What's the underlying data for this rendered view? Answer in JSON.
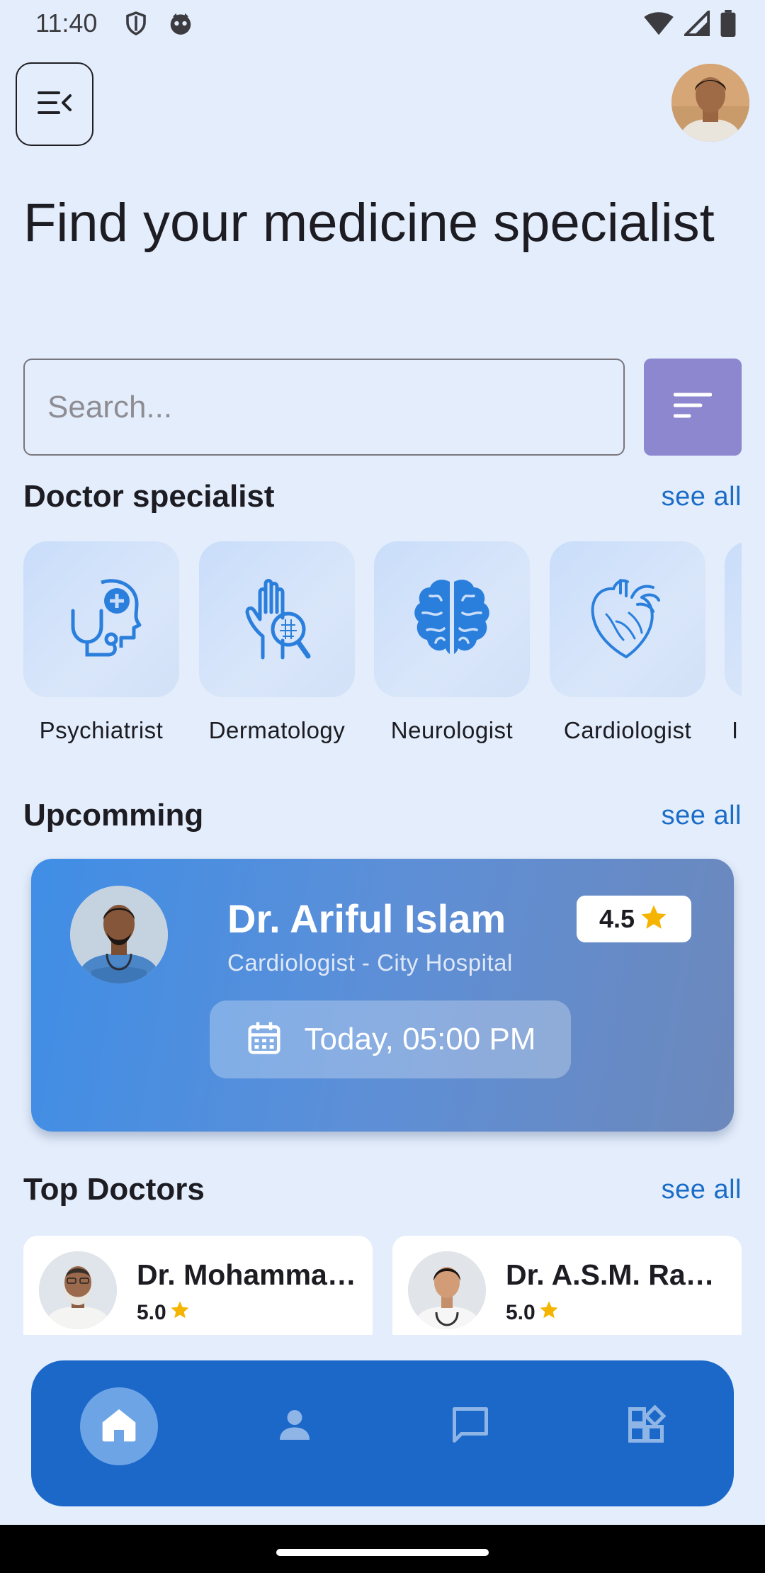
{
  "status_bar": {
    "time": "11:40"
  },
  "header": {
    "title": "Find your medicine specialist"
  },
  "search": {
    "placeholder": "Search..."
  },
  "specialists": {
    "title": "Doctor specialist",
    "see_all": "see all",
    "items": [
      {
        "label": "Psychiatrist",
        "icon": "psychiatry-icon"
      },
      {
        "label": "Dermatology",
        "icon": "dermatology-icon"
      },
      {
        "label": "Neurologist",
        "icon": "brain-icon"
      },
      {
        "label": "Cardiologist",
        "icon": "heart-icon"
      }
    ]
  },
  "upcoming": {
    "title": "Upcomming",
    "see_all": "see all",
    "card": {
      "name": "Dr. Ariful Islam",
      "subtitle": "Cardiologist - City Hospital",
      "rating": "4.5",
      "time": "Today, 05:00 PM"
    }
  },
  "top_doctors": {
    "title": "Top Doctors",
    "see_all": "see all",
    "items": [
      {
        "name": "Dr. Mohammad Rahman",
        "rating": "5.0"
      },
      {
        "name": "Dr. A.S.M. Rashid",
        "rating": "5.0"
      }
    ]
  },
  "nav": {
    "items": [
      "home-icon",
      "profile-icon",
      "chat-icon",
      "dashboard-icon"
    ],
    "active": "home"
  },
  "colors": {
    "background": "#e3edfb",
    "accent": "#1b68c9",
    "link": "#1a6cc7",
    "filter": "#8c87cf",
    "star": "#f5b400"
  }
}
